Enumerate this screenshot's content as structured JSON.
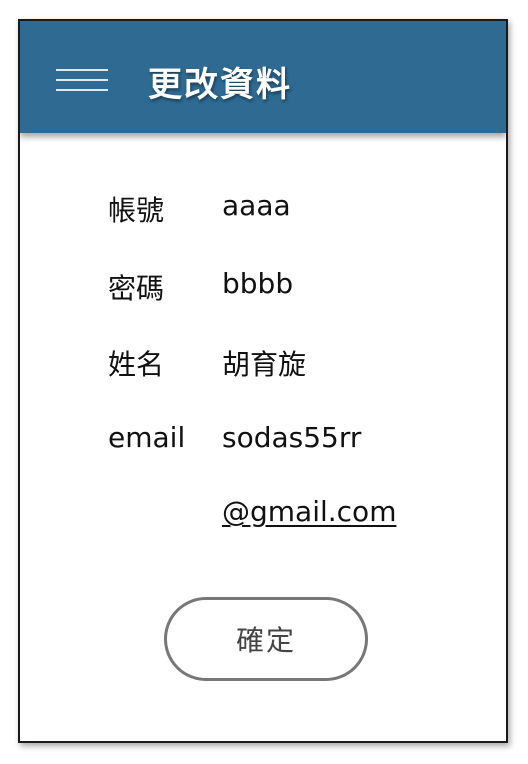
{
  "header": {
    "title": "更改資料",
    "menu_icon": "hamburger-menu-icon",
    "background_color": "#2e6a92"
  },
  "form": {
    "account": {
      "label": "帳號",
      "value": "aaaa"
    },
    "password": {
      "label": "密碼",
      "value": "bbbb"
    },
    "name": {
      "label": "姓名",
      "value": "胡育旋"
    },
    "email": {
      "label": "email",
      "value_line1": "sodas55rr",
      "value_line2": "@gmail.com"
    }
  },
  "confirm_button": {
    "label": "確定"
  }
}
